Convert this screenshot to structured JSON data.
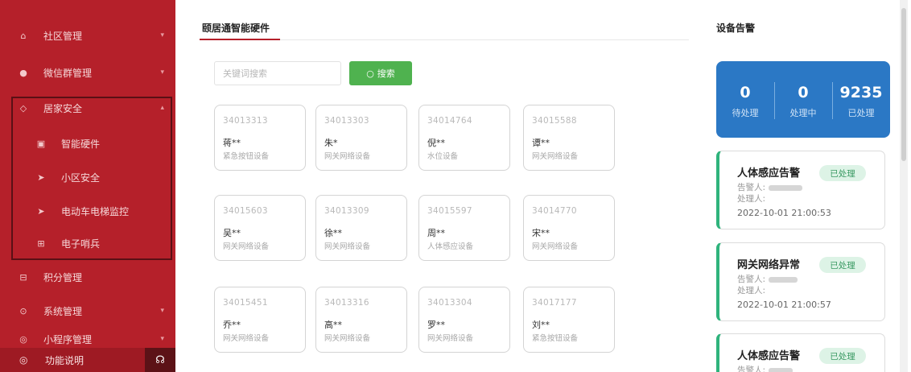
{
  "sidebar": {
    "items": [
      {
        "label": "社区管理",
        "icon": "community-icon"
      },
      {
        "label": "微信群管理",
        "icon": "wechat-icon"
      },
      {
        "label": "居家安全",
        "icon": "shield-icon"
      },
      {
        "label": "智能硬件",
        "icon": "hardware-icon"
      },
      {
        "label": "小区安全",
        "icon": "camera-icon"
      },
      {
        "label": "电动车电梯监控",
        "icon": "monitor-icon"
      },
      {
        "label": "电子哨兵",
        "icon": "sentinel-icon"
      },
      {
        "label": "积分管理",
        "icon": "points-icon"
      },
      {
        "label": "系统管理",
        "icon": "settings-icon"
      },
      {
        "label": "小程序管理",
        "icon": "miniapp-icon"
      }
    ],
    "footer": {
      "label": "功能说明",
      "icon": "info-icon",
      "help_icon": "headset-icon"
    }
  },
  "main": {
    "title": "颐居通智能硬件",
    "search": {
      "placeholder": "关键词搜索",
      "button_label": "搜索",
      "icon": "search-icon"
    },
    "devices": [
      {
        "id": "34013313",
        "name": "蒋**",
        "type": "紧急按钮设备"
      },
      {
        "id": "34013303",
        "name": "朱*",
        "type": "网关网络设备"
      },
      {
        "id": "34014764",
        "name": "倪**",
        "type": "水位设备"
      },
      {
        "id": "34015588",
        "name": "谭**",
        "type": "网关网络设备"
      },
      {
        "id": "34015603",
        "name": "吴**",
        "type": "网关网络设备"
      },
      {
        "id": "34013309",
        "name": "徐**",
        "type": "网关网络设备"
      },
      {
        "id": "34015597",
        "name": "周**",
        "type": "人体感应设备"
      },
      {
        "id": "34014770",
        "name": "宋**",
        "type": "网关网络设备"
      },
      {
        "id": "34015451",
        "name": "乔**",
        "type": "网关网络设备"
      },
      {
        "id": "34013316",
        "name": "高**",
        "type": "网关网络设备"
      },
      {
        "id": "34013304",
        "name": "罗**",
        "type": "网关网络设备"
      },
      {
        "id": "34017177",
        "name": "刘**",
        "type": "紧急按钮设备"
      }
    ]
  },
  "alarms": {
    "title": "设备告警",
    "stats": [
      {
        "value": "0",
        "label": "待处理"
      },
      {
        "value": "0",
        "label": "处理中"
      },
      {
        "value": "9235",
        "label": "已处理"
      }
    ],
    "items": [
      {
        "title": "人体感应告警",
        "status": "已处理",
        "reporter_label": "告警人:",
        "handler_label": "处理人:",
        "time": "2022-10-01 21:00:53"
      },
      {
        "title": "网关网络异常",
        "status": "已处理",
        "reporter_label": "告警人:",
        "handler_label": "处理人:",
        "time": "2022-10-01 21:00:57"
      },
      {
        "title": "人体感应告警",
        "status": "已处理",
        "reporter_label": "告警人:",
        "handler_label": "",
        "time": ""
      }
    ]
  },
  "colors": {
    "sidebar": "#b5202a",
    "accent_green": "#4fb24f",
    "stats_blue": "#2b78c5",
    "status_green": "#2fb37c"
  }
}
